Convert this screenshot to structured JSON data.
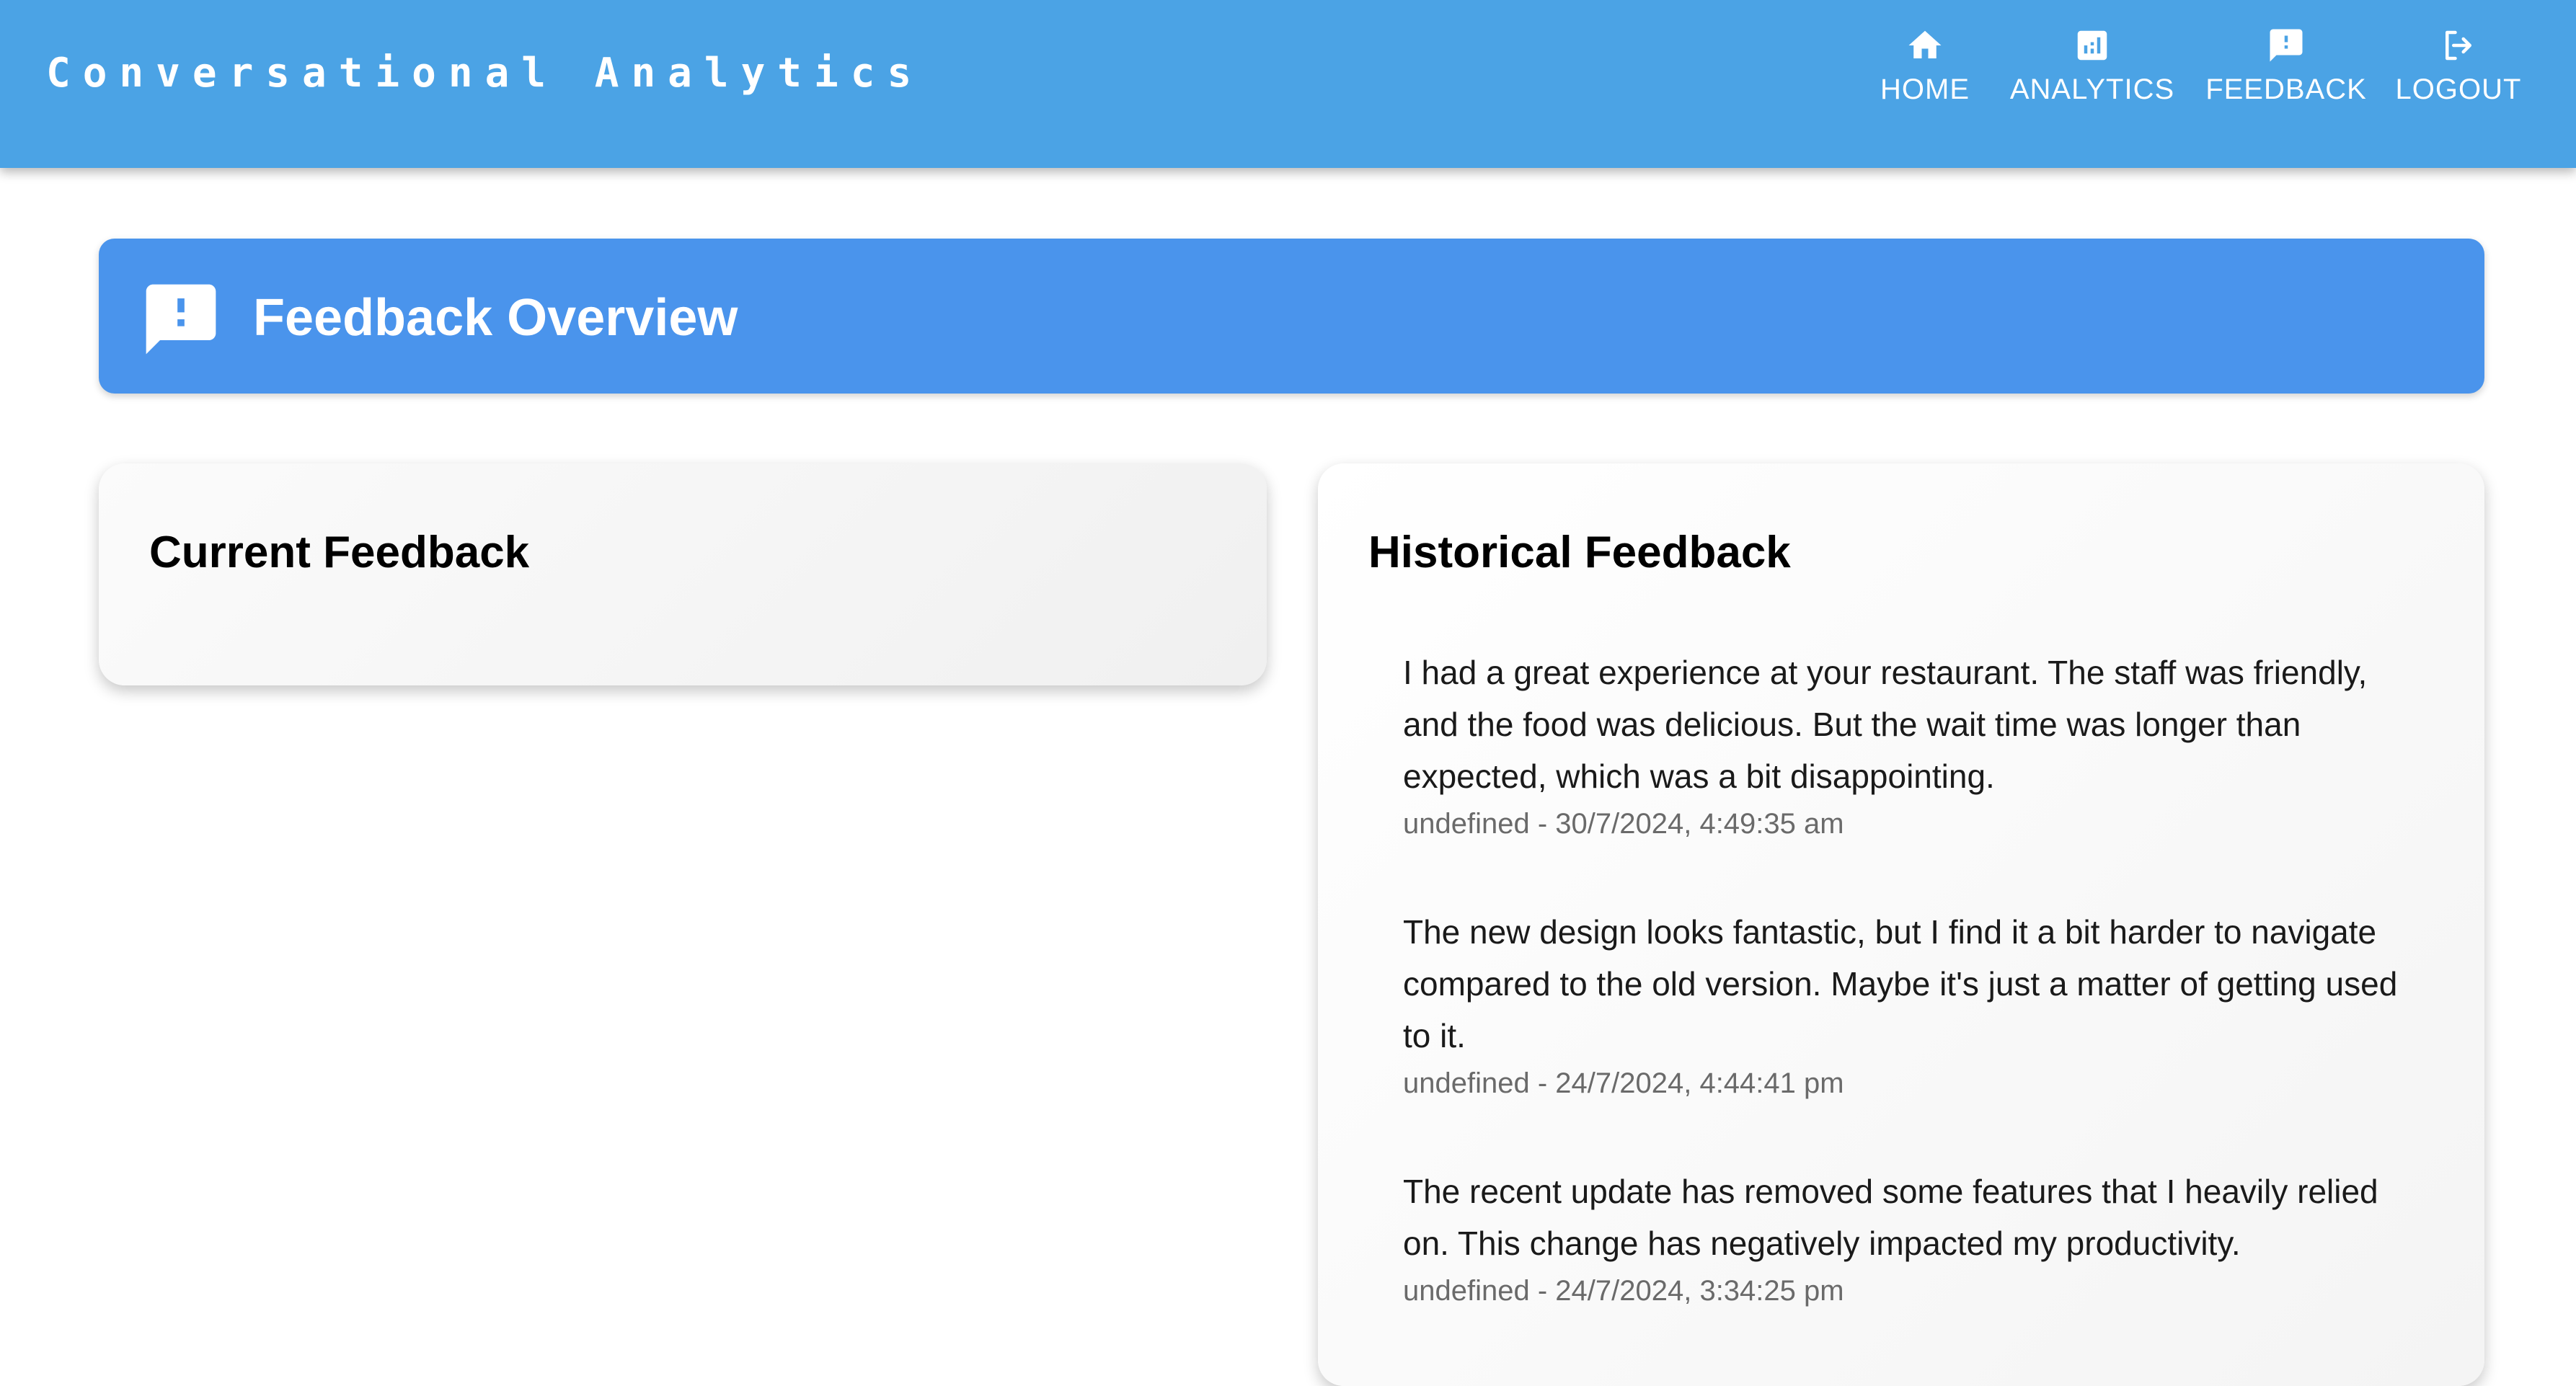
{
  "app": {
    "title": "Conversational Analytics"
  },
  "nav": {
    "items": [
      {
        "label": "HOME",
        "icon": "home-icon"
      },
      {
        "label": "ANALYTICS",
        "icon": "analytics-icon"
      },
      {
        "label": "FEEDBACK",
        "icon": "feedback-icon"
      },
      {
        "label": "LOGOUT",
        "icon": "logout-icon"
      }
    ]
  },
  "header": {
    "title": "Feedback Overview",
    "icon": "feedback-icon"
  },
  "current_feedback": {
    "title": "Current Feedback"
  },
  "historical_feedback": {
    "title": "Historical Feedback",
    "items": [
      {
        "text": "I had a great experience at your restaurant. The staff was friendly, and the food was delicious. But the wait time was longer than expected, which was a bit disappointing.",
        "meta": "undefined - 30/7/2024, 4:49:35 am"
      },
      {
        "text": "The new design looks fantastic, but I find it a bit harder to navigate compared to the old version. Maybe it's just a matter of getting used to it.",
        "meta": "undefined - 24/7/2024, 4:44:41 pm"
      },
      {
        "text": "The recent update has removed some features that I heavily relied on. This change has negatively impacted my productivity.",
        "meta": "undefined - 24/7/2024, 3:34:25 pm"
      }
    ]
  },
  "colors": {
    "appbar": "#4ba3e5",
    "header_card": "#4a94ec",
    "card_bg": "#f5f5f5",
    "meta_text": "#6a6a6a"
  }
}
